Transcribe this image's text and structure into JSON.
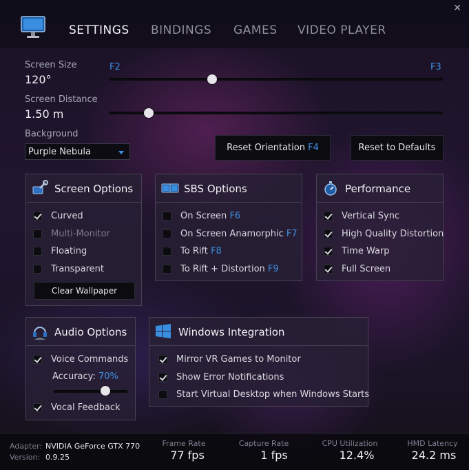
{
  "tabs": [
    "SETTINGS",
    "BINDINGS",
    "GAMES",
    "VIDEO PLAYER"
  ],
  "close_glyph": "✕",
  "screen_size": {
    "label": "Screen Size",
    "value": "120°",
    "min_key": "F2",
    "max_key": "F3",
    "level": 0.31
  },
  "screen_distance": {
    "label": "Screen Distance",
    "value": "1.50 m",
    "level": 0.12
  },
  "background": {
    "label": "Background",
    "selected": "Purple Nebula"
  },
  "buttons": {
    "reset_orientation": "Reset Orientation",
    "reset_orientation_key": "F4",
    "reset_defaults": "Reset to Defaults"
  },
  "screen_options": {
    "title": "Screen Options",
    "items": [
      {
        "label": "Curved",
        "checked": true,
        "disabled": false
      },
      {
        "label": "Multi-Monitor",
        "checked": false,
        "disabled": true
      },
      {
        "label": "Floating",
        "checked": false,
        "disabled": false
      },
      {
        "label": "Transparent",
        "checked": false,
        "disabled": false
      }
    ],
    "clear_wallpaper": "Clear Wallpaper"
  },
  "sbs_options": {
    "title": "SBS Options",
    "items": [
      {
        "label": "On Screen",
        "key": "F6",
        "checked": false
      },
      {
        "label": "On Screen Anamorphic",
        "key": "F7",
        "checked": false
      },
      {
        "label": "To Rift",
        "key": "F8",
        "checked": false
      },
      {
        "label": "To Rift + Distortion",
        "key": "F9",
        "checked": false
      }
    ]
  },
  "performance": {
    "title": "Performance",
    "items": [
      {
        "label": "Vertical Sync",
        "checked": true
      },
      {
        "label": "High Quality Distortion",
        "checked": true
      },
      {
        "label": "Time Warp",
        "checked": true
      },
      {
        "label": "Full Screen",
        "checked": true
      }
    ]
  },
  "audio_options": {
    "title": "Audio Options",
    "voice_commands": "Voice Commands",
    "voice_commands_checked": true,
    "accuracy_label": "Accuracy:",
    "accuracy_value": "70%",
    "accuracy_level": 0.7,
    "vocal_feedback": "Vocal Feedback",
    "vocal_feedback_checked": true
  },
  "windows_integration": {
    "title": "Windows Integration",
    "items": [
      {
        "label": "Mirror VR Games to Monitor",
        "checked": true
      },
      {
        "label": "Show Error Notifications",
        "checked": true
      },
      {
        "label": "Start Virtual Desktop when Windows Starts",
        "checked": false
      }
    ]
  },
  "footer": {
    "adapter_label": "Adapter:",
    "adapter_value": "NVIDIA GeForce GTX 770",
    "version_label": "Version:",
    "version_value": "0.9.25",
    "stats": [
      {
        "label": "Frame Rate",
        "value": "77 fps"
      },
      {
        "label": "Capture Rate",
        "value": "1 fps"
      },
      {
        "label": "CPU Utilization",
        "value": "12.4%"
      },
      {
        "label": "HMD Latency",
        "value": "24.2 ms"
      }
    ]
  },
  "colors": {
    "accent": "#3f8fe0"
  }
}
